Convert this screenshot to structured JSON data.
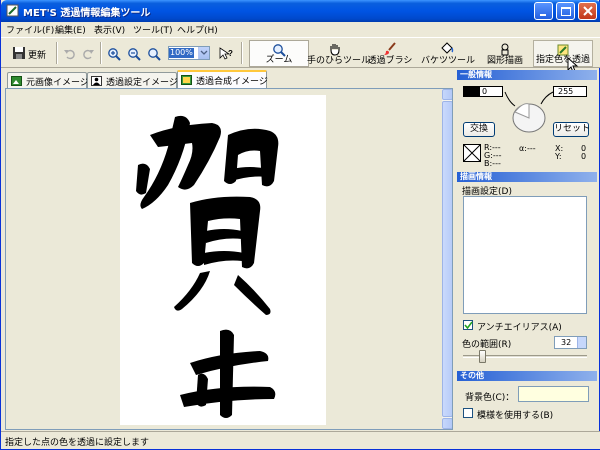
{
  "window": {
    "title": "MET'S 透過情報編集ツール"
  },
  "menu": [
    "ファイル(F)",
    "編集(E)",
    "表示(V)",
    "ツール(T)",
    "ヘルプ(H)"
  ],
  "toolbar": {
    "save_label": "更新",
    "zoom_value": "100%",
    "tools": [
      {
        "label": "ズーム",
        "icon": "zoom-icon"
      },
      {
        "label": "手のひらツール",
        "icon": "hand-icon"
      },
      {
        "label": "透過ブラシ",
        "icon": "brush-icon"
      },
      {
        "label": "バケツツール",
        "icon": "bucket-icon"
      },
      {
        "label": "図形描画",
        "icon": "shape-icon"
      },
      {
        "label": "指定色を透過",
        "icon": "eyedropper-icon"
      }
    ]
  },
  "tabs": [
    {
      "label": "元画像イメージ",
      "icon": "image-icon"
    },
    {
      "label": "透過設定イメージ",
      "icon": "person-icon"
    },
    {
      "label": "透過合成イメージ",
      "icon": "composite-icon"
    }
  ],
  "panel": {
    "general_title": "一般情報",
    "left_color_value": "0",
    "right_color_value": "255",
    "swap_button": "交換",
    "reset_button": "リセット",
    "rgb_label": "R:---\nG:---\nB:---",
    "alpha_label": "α:---",
    "x_label": "X:",
    "x_value": "0",
    "y_label": "Y:",
    "y_value": "0",
    "draw_title": "描画情報",
    "draw_setting_label": "描画設定(D)",
    "antialias_label": "アンチエイリアス(A)",
    "antialias_checked": true,
    "color_range_label": "色の範囲(R)",
    "color_range_value": "32",
    "other_title": "その他",
    "bg_color_label": "背景色(C)：",
    "bg_color": "#ffffe0",
    "pattern_label": "模様を使用する(B)",
    "pattern_checked": false
  },
  "status": {
    "text": "指定した点の色を透過に設定します"
  },
  "colors": {
    "title_bar": "#0054e3",
    "section_header": "#2660d4",
    "active_tab_accent": "#ffc83c"
  }
}
